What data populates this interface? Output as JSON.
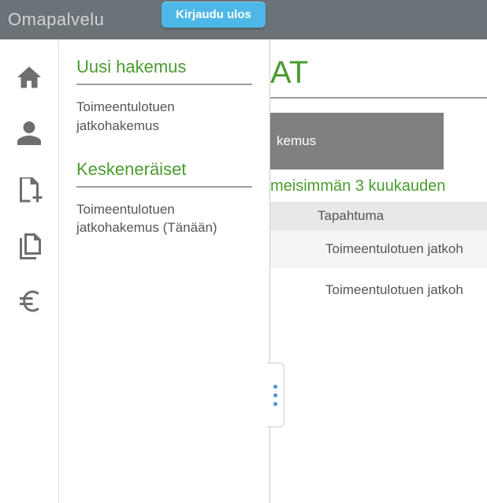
{
  "topbar": {
    "brand": "Omapalvelu",
    "logout": "Kirjaudu ulos"
  },
  "flyout": {
    "section1": {
      "heading": "Uusi hakemus",
      "link": "Toimeentulotuen jatkohakemus"
    },
    "section2": {
      "heading": "Keskeneräiset",
      "link": "Toimeentulotuen jatkohakemus (Tänään)"
    }
  },
  "main": {
    "title_fragment": "AT",
    "panel_text": "kemus",
    "subheading_fragment": "meisimmän 3 kuukauden",
    "table": {
      "header": "Tapahtuma",
      "rows": [
        "Toimeentulotuen jatkoh",
        "Toimeentulotuen jatkoh"
      ]
    }
  }
}
